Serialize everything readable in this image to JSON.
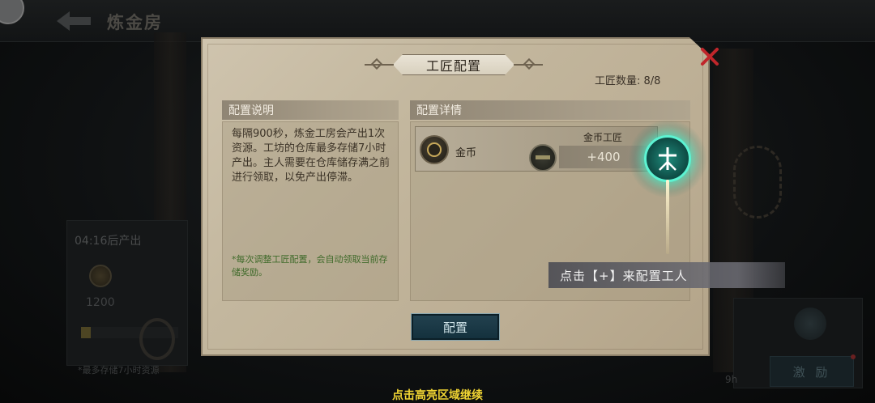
{
  "background": {
    "page_title": "炼金房",
    "timer_text": "04:16后产出",
    "amount": "1200",
    "storage_note": "*最多存储7小时资源",
    "right_time": "9h",
    "reward_button": "激 励"
  },
  "dialog": {
    "title": "工匠配置",
    "worker_count_label": "工匠数量: 8/8",
    "left_header": "配置说明",
    "description": "每隔900秒，炼金工房会产出1次资源。工坊的仓库最多存储7小时产出。主人需要在仓库储存满之前进行领取，以免产出停滞。",
    "note": "*每次调整工匠配置，会自动领取当前存储奖励。",
    "right_header": "配置详情",
    "row": {
      "resource": "金币",
      "worker_type": "金币工匠",
      "bonus": "+400"
    },
    "config_button": "配置"
  },
  "tutorial": {
    "tip": "点击【+】来配置工人",
    "continue_hint": "点击高亮区域继续"
  },
  "colors": {
    "highlight": "#5cf3d2",
    "continue_text": "#f2d633",
    "close_red": "#c0262b"
  }
}
